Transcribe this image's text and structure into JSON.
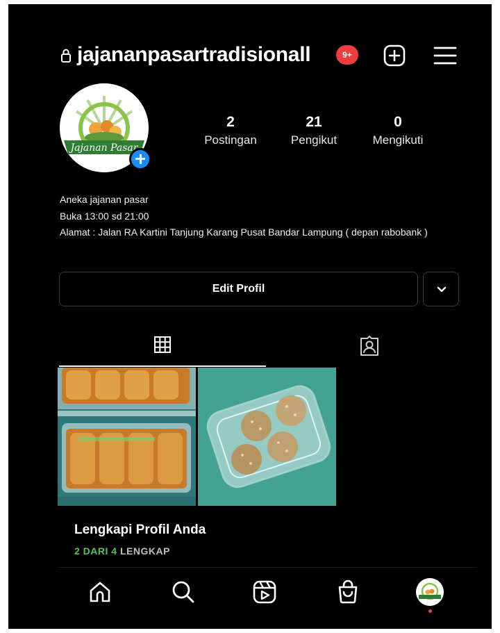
{
  "header": {
    "username": "jajananpasartradisionall",
    "notification_badge": "9+",
    "icons": [
      "lock-icon",
      "new-post-icon",
      "menu-icon"
    ]
  },
  "profile": {
    "avatar_logo_text": "Jajanan Pasar",
    "stats": {
      "posts_count": "2",
      "posts_label": "Postingan",
      "followers_count": "21",
      "followers_label": "Pengikut",
      "following_count": "0",
      "following_label": "Mengikuti"
    },
    "bio": {
      "line1": "Aneka jajanan pasar",
      "line2": "Buka 13:00 sd 21:00",
      "line3": "Alamat : Jalan RA Kartini Tanjung Karang Pusat Bandar Lampung ( depan rabobank )"
    },
    "edit_button_label": "Edit Profil"
  },
  "tabs": [
    {
      "name": "posts-grid",
      "icon": "grid-icon",
      "active": true
    },
    {
      "name": "tagged",
      "icon": "tagged-icon",
      "active": false
    }
  ],
  "complete_profile": {
    "title": "Lengkapi Profil Anda",
    "progress_done": "2 DARI 4",
    "progress_rest": "LENGKAP"
  },
  "bottom_nav": [
    "home-icon",
    "search-icon",
    "reels-icon",
    "shop-icon",
    "profile-avatar"
  ],
  "colors": {
    "background": "#000000",
    "badge": "#ee3b3b",
    "add_button": "#1d8cf0",
    "progress_green": "#58c35c"
  }
}
